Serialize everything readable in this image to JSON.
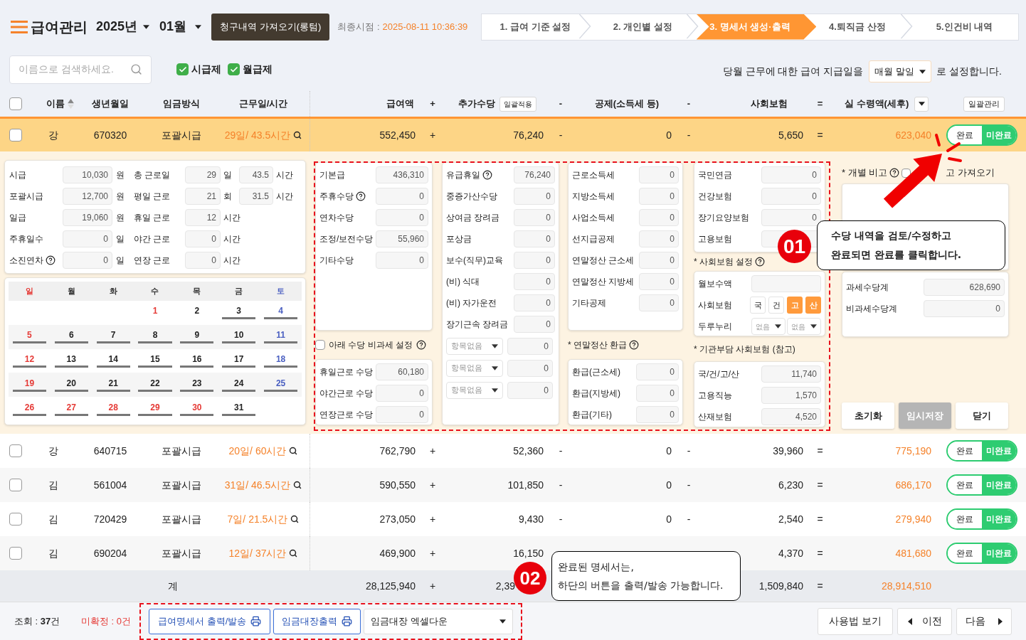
{
  "header": {
    "title": "급여관리",
    "year": "2025년",
    "month": "01월",
    "fetch_button": "청구내역 가져오기(롱텀)",
    "last_label": "최종시점 :",
    "last_time": "2025-08-11 10:36:39"
  },
  "steps": [
    {
      "label": "1. 급여 기준 설정",
      "selected": false
    },
    {
      "label": "2. 개인별 설정",
      "selected": false
    },
    {
      "label": "3. 명세서 생성·출력",
      "selected": true
    },
    {
      "label": "4.퇴직금 산정",
      "selected": false
    },
    {
      "label": "5.인건비 내역",
      "selected": false
    }
  ],
  "filters": {
    "search_placeholder": "이름으로 검색하세요.",
    "types": [
      {
        "label": "시급제",
        "checked": true
      },
      {
        "label": "월급제",
        "checked": true
      }
    ],
    "payday_prefix": "당월 근무에 대한 급여 지급일을",
    "payday_value": "매월 말일",
    "payday_suffix": "로 설정합니다."
  },
  "columns": {
    "select_all": false,
    "name": "이름",
    "birth": "생년월일",
    "wage": "임금방식",
    "work": "근무일/시간",
    "pay": "급여액",
    "op1": "+",
    "extra": "추가수당",
    "extra_button": "일괄적용",
    "op2": "-",
    "deduct": "공제(소득세 등)",
    "op3": "-",
    "insurance": "사회보험",
    "op4": "=",
    "net": "실 수령액(세후)",
    "manage_button": "일괄관리"
  },
  "rows": [
    {
      "checked": false,
      "expanded": true,
      "name": "강",
      "birth": "670320",
      "wage": "포괄시급",
      "work": "29일/ 43.5시간",
      "pay": "552,450",
      "op1": "+",
      "extra": "76,240",
      "op2": "-",
      "deduct": "0",
      "op3": "-",
      "insurance": "5,650",
      "op4": "=",
      "net": "623,040",
      "done": false,
      "done_label": "완료",
      "pending_label": "미완료"
    },
    {
      "checked": false,
      "expanded": false,
      "name": "강",
      "birth": "640715",
      "wage": "포괄시급",
      "work": "20일/ 60시간",
      "pay": "762,790",
      "op1": "+",
      "extra": "52,360",
      "op2": "-",
      "deduct": "0",
      "op3": "-",
      "insurance": "39,960",
      "op4": "=",
      "net": "775,190",
      "done": false,
      "done_label": "완료",
      "pending_label": "미완료"
    },
    {
      "checked": false,
      "expanded": false,
      "name": "김",
      "birth": "561004",
      "wage": "포괄시급",
      "work": "31일/ 46.5시간",
      "pay": "590,550",
      "op1": "+",
      "extra": "101,850",
      "op2": "-",
      "deduct": "0",
      "op3": "-",
      "insurance": "6,230",
      "op4": "=",
      "net": "686,170",
      "done": false,
      "done_label": "완료",
      "pending_label": "미완료"
    },
    {
      "checked": false,
      "expanded": false,
      "name": "김",
      "birth": "720429",
      "wage": "포괄시급",
      "work": "7일/ 21.5시간",
      "pay": "273,050",
      "op1": "+",
      "extra": "9,430",
      "op2": "-",
      "deduct": "0",
      "op3": "-",
      "insurance": "2,540",
      "op4": "=",
      "net": "279,940",
      "done": false,
      "done_label": "완료",
      "pending_label": "미완료"
    },
    {
      "checked": false,
      "expanded": false,
      "name": "김",
      "birth": "690204",
      "wage": "포괄시급",
      "work": "12일/ 37시간",
      "pay": "469,900",
      "op1": "+",
      "extra": "16,150",
      "insurance": "4,370",
      "op4": "=",
      "net": "481,680",
      "done": false,
      "done_label": "완료",
      "pending_label": "미완료"
    }
  ],
  "detail": {
    "info": [
      {
        "label": "시급",
        "help": false,
        "value": "10,030",
        "unit": "원",
        "label2": "총 근로일",
        "value2": "29",
        "unit2": "일",
        "value3": "43.5",
        "unit3": "시간"
      },
      {
        "label": "포괄시급",
        "help": false,
        "value": "12,700",
        "unit": "원",
        "label2": "평일 근로",
        "value2": "21",
        "unit2": "회",
        "value3": "31.5",
        "unit3": "시간"
      },
      {
        "label": "일급",
        "help": false,
        "value": "19,060",
        "unit": "원",
        "label2": "휴일 근로",
        "value2": "12",
        "unit2": "시간"
      },
      {
        "label": "주휴일수",
        "help": false,
        "value": "0",
        "unit": "일",
        "label2": "야간 근로",
        "value2": "0",
        "unit2": "시간"
      },
      {
        "label": "소진연차",
        "help": true,
        "value": "0",
        "unit": "일",
        "label2": "연장 근로",
        "value2": "0",
        "unit2": "시간"
      }
    ],
    "calendar": {
      "weekdays": [
        {
          "label": "일",
          "color": "#e53935"
        },
        {
          "label": "월",
          "color": "#333333"
        },
        {
          "label": "화",
          "color": "#333333"
        },
        {
          "label": "수",
          "color": "#333333"
        },
        {
          "label": "목",
          "color": "#333333"
        },
        {
          "label": "금",
          "color": "#333333"
        },
        {
          "label": "토",
          "color": "#4a5fc1"
        }
      ],
      "weeks": [
        [
          {
            "day": "1",
            "color": "#e53935",
            "worked": false
          },
          {
            "day": "2",
            "color": "#222222",
            "worked": false
          },
          {
            "day": "3",
            "color": "#222222",
            "worked": true
          },
          {
            "day": "4",
            "color": "#4a5fc1",
            "worked": true
          }
        ],
        [
          {
            "day": "5",
            "color": "#e53935",
            "worked": true
          },
          {
            "day": "6",
            "color": "#222222",
            "worked": true
          },
          {
            "day": "7",
            "color": "#222222",
            "worked": true
          },
          {
            "day": "8",
            "color": "#222222",
            "worked": true
          },
          {
            "day": "9",
            "color": "#222222",
            "worked": true
          },
          {
            "day": "10",
            "color": "#222222",
            "worked": true
          },
          {
            "day": "11",
            "color": "#4a5fc1",
            "worked": true
          }
        ],
        [
          {
            "day": "12",
            "color": "#e53935",
            "worked": true
          },
          {
            "day": "13",
            "color": "#222222",
            "worked": true
          },
          {
            "day": "14",
            "color": "#222222",
            "worked": true
          },
          {
            "day": "15",
            "color": "#222222",
            "worked": true
          },
          {
            "day": "16",
            "color": "#222222",
            "worked": true
          },
          {
            "day": "17",
            "color": "#222222",
            "worked": true
          },
          {
            "day": "18",
            "color": "#4a5fc1",
            "worked": true
          }
        ],
        [
          {
            "day": "19",
            "color": "#e53935",
            "worked": true
          },
          {
            "day": "20",
            "color": "#222222",
            "worked": true
          },
          {
            "day": "21",
            "color": "#222222",
            "worked": true
          },
          {
            "day": "22",
            "color": "#222222",
            "worked": true
          },
          {
            "day": "23",
            "color": "#222222",
            "worked": true
          },
          {
            "day": "24",
            "color": "#222222",
            "worked": true
          },
          {
            "day": "25",
            "color": "#4a5fc1",
            "worked": true
          }
        ],
        [
          {
            "day": "26",
            "color": "#e53935",
            "worked": true
          },
          {
            "day": "27",
            "color": "#e53935",
            "worked": true
          },
          {
            "day": "28",
            "color": "#e53935",
            "worked": true
          },
          {
            "day": "29",
            "color": "#e53935",
            "worked": true
          },
          {
            "day": "30",
            "color": "#e53935",
            "worked": true
          },
          {
            "day": "31",
            "color": "#222222",
            "worked": true
          }
        ]
      ]
    },
    "pay_items": [
      {
        "label": "기본급",
        "help": false,
        "value": "436,310"
      },
      {
        "label": "주휴수당",
        "help": true,
        "value": "0"
      },
      {
        "label": "연차수당",
        "help": false,
        "value": "0"
      },
      {
        "label": "조정/보전수당",
        "help": false,
        "value": "55,960"
      },
      {
        "label": "기타수당",
        "help": false,
        "value": "0"
      }
    ],
    "taxfree_toggle": {
      "label": "아래 수당 비과세 설정",
      "checked": false,
      "help": true
    },
    "overtime_items": [
      {
        "label": "휴일근로 수당",
        "help": false,
        "value": "60,180"
      },
      {
        "label": "야간근로 수당",
        "help": false,
        "value": "0"
      },
      {
        "label": "연장근로 수당",
        "help": false,
        "value": "0"
      }
    ],
    "extra_items": [
      {
        "kind": "field",
        "label": "유급휴일",
        "help": true,
        "value": "76,240"
      },
      {
        "kind": "field",
        "label": "중증가산수당",
        "help": false,
        "value": "0"
      },
      {
        "kind": "field",
        "label": "상여금 장려금",
        "help": false,
        "value": "0"
      },
      {
        "kind": "field",
        "label": "포상금",
        "help": false,
        "value": "0"
      },
      {
        "kind": "field",
        "label": "보수(직무)교육",
        "help": false,
        "value": "0"
      },
      {
        "kind": "field",
        "label": "(비) 식대",
        "help": false,
        "value": "0"
      },
      {
        "kind": "field",
        "label": "(비) 자가운전",
        "help": false,
        "value": "0"
      },
      {
        "kind": "field",
        "label": "장기근속 장려금",
        "help": false,
        "value": "0"
      },
      {
        "kind": "select",
        "label": "항목없음",
        "help": false,
        "value": "0"
      },
      {
        "kind": "select",
        "label": "항목없음",
        "help": false,
        "value": "0"
      },
      {
        "kind": "select",
        "label": "항목없음",
        "help": false,
        "value": "0"
      }
    ],
    "tax_items": [
      {
        "label": "근로소득세",
        "help": false,
        "value": "0"
      },
      {
        "label": "지방소득세",
        "help": false,
        "value": "0"
      },
      {
        "label": "사업소득세",
        "help": false,
        "value": "0"
      },
      {
        "label": "선지급공제",
        "help": false,
        "value": "0"
      },
      {
        "label": "연말정산 근소세",
        "help": false,
        "value": "0"
      },
      {
        "label": "연말정산 지방세",
        "help": false,
        "value": "0"
      },
      {
        "label": "기타공제",
        "help": false,
        "value": "0"
      }
    ],
    "refund_label": "* 연말정산 환급",
    "refund_help": true,
    "refund_items": [
      {
        "label": "환급(근소세)",
        "help": false,
        "value": "0"
      },
      {
        "label": "환급(지방세)",
        "help": false,
        "value": "0"
      },
      {
        "label": "환급(기타)",
        "help": false,
        "value": "0"
      }
    ],
    "insurance_items": [
      {
        "label": "국민연금",
        "help": false,
        "value": "0"
      },
      {
        "label": "건강보험",
        "help": false,
        "value": "0"
      },
      {
        "label": "장기요양보험",
        "help": false,
        "value": "0"
      },
      {
        "label": "고용보험",
        "help": false
      }
    ],
    "insurance_setting_label": "* 사회보험 설정",
    "insurance_setting_help": true,
    "insurance_settings": [
      {
        "kind": "field",
        "label": "월보수액"
      },
      {
        "kind": "chips",
        "label": "사회보험",
        "chips": [
          {
            "label": "국",
            "on": false
          },
          {
            "label": "건",
            "on": false
          },
          {
            "label": "고",
            "on": true
          },
          {
            "label": "산",
            "on": true
          }
        ]
      },
      {
        "kind": "selects",
        "label": "두루누리",
        "options": [
          "없음",
          "없음"
        ]
      }
    ],
    "employer_label": "* 기관부담 사회보험 (참고)",
    "employer_items": [
      {
        "label": "국/건/고/산",
        "help": false,
        "value": "11,740"
      },
      {
        "label": "고용직능",
        "help": false,
        "value": "1,570"
      },
      {
        "label": "산재보험",
        "help": false,
        "value": "4,520"
      }
    ],
    "note": {
      "label": "* 개별 비고",
      "help": true,
      "checked": false,
      "import_label": "고 가져오기"
    },
    "totals": [
      {
        "label": "과세수당계",
        "help": false,
        "value": "628,690"
      },
      {
        "label": "비과세수당계",
        "help": false,
        "value": "0"
      }
    ],
    "buttons": [
      {
        "label": "초기화",
        "disabled": false
      },
      {
        "label": "임시저장",
        "disabled": true
      },
      {
        "label": "닫기",
        "disabled": false
      }
    ]
  },
  "sum": {
    "label": "계",
    "pay": "28,125,940",
    "op1": "+",
    "extra": "2,39",
    "insurance": "1,509,840",
    "op4": "=",
    "net": "28,914,510"
  },
  "footer": {
    "count": "조회 : **37**건",
    "unconfirmed": "미확정 : 0건",
    "print_button": "급여명세서 출력/발송",
    "ledger_button": "임금대장출력",
    "excel_select": "임금대장 엑셀다운",
    "help_button": "사용법 보기",
    "prev_button": "이전",
    "next_button": "다음"
  },
  "annotations": {
    "step1": {
      "badge": "01",
      "lines": [
        "수당 내역을 검토/수정하고",
        "완료되면 완료를 클릭합니다."
      ]
    },
    "step2": {
      "badge": "02",
      "lines": [
        "완료된 명세서는,",
        "하단의 버튼을 출력/발송 가능합니다."
      ]
    }
  }
}
